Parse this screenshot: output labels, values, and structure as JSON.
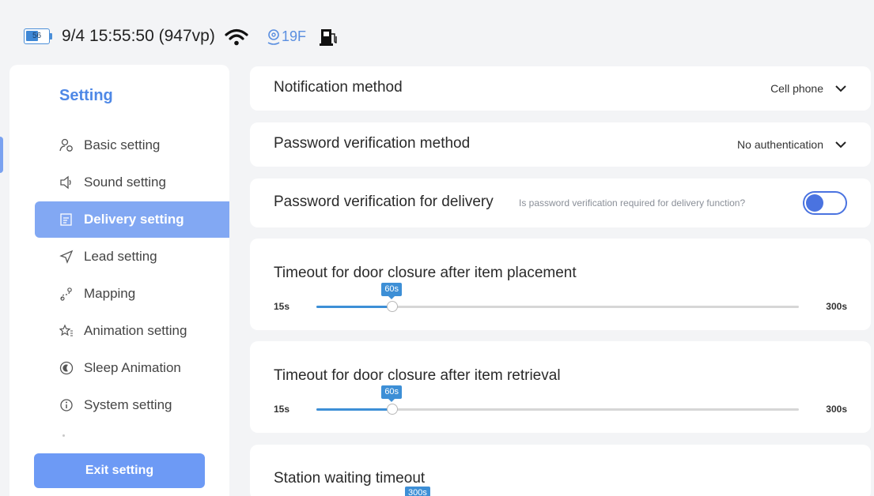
{
  "status_bar": {
    "battery_level": "56",
    "battery_fraction": 0.56,
    "datetime": "9/4 15:55:50 (947vp)",
    "floor": "19F",
    "icons": [
      "battery-icon",
      "wifi-icon",
      "location-icon",
      "charging-station-icon"
    ]
  },
  "sidebar": {
    "title": "Setting",
    "items": [
      {
        "label": "Basic setting",
        "icon": "user-settings-icon"
      },
      {
        "label": "Sound setting",
        "icon": "speaker-icon"
      },
      {
        "label": "Delivery setting",
        "icon": "edit-note-icon",
        "active": true
      },
      {
        "label": "Lead setting",
        "icon": "paper-plane-icon"
      },
      {
        "label": "Mapping",
        "icon": "map-route-icon"
      },
      {
        "label": "Animation setting",
        "icon": "star-list-icon"
      },
      {
        "label": "Sleep Animation",
        "icon": "moon-icon"
      },
      {
        "label": "System setting",
        "icon": "info-icon"
      }
    ],
    "exit_label": "Exit setting"
  },
  "settings": {
    "notification": {
      "label": "Notification method",
      "value": "Cell phone"
    },
    "password_method": {
      "label": "Password verification method",
      "value": "No authentication"
    },
    "password_delivery": {
      "label": "Password verification for delivery",
      "hint": "Is password verification required for delivery function?",
      "enabled": false
    },
    "timeout_placement": {
      "label": "Timeout for door closure after item placement",
      "min": "15s",
      "max": "300s",
      "value": "60s",
      "min_value": 15,
      "max_value": 300,
      "current_value": 60
    },
    "timeout_retrieval": {
      "label": "Timeout for door closure after item retrieval",
      "min": "15s",
      "max": "300s",
      "value": "60s",
      "min_value": 15,
      "max_value": 300,
      "current_value": 60
    },
    "station_wait": {
      "label": "Station waiting timeout",
      "value": "300s"
    }
  },
  "colors": {
    "accent": "#4e88e6",
    "active_nav": "#82a8f3",
    "slider": "#3d8fd6",
    "toggle": "#4a73e0",
    "exit_button": "#6d9af5"
  }
}
